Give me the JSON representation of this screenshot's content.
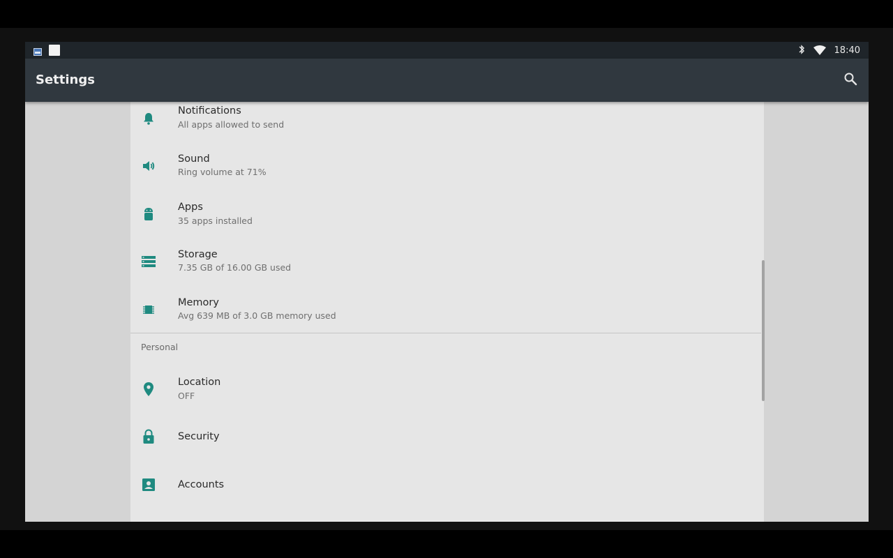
{
  "status_bar": {
    "time": "18:40",
    "left_icons": [
      "screen-cast-icon",
      "notification-square-icon"
    ],
    "right_icons": [
      "bluetooth-icon",
      "wifi-icon"
    ]
  },
  "app_bar": {
    "title": "Settings",
    "search_icon": "search-icon"
  },
  "colors": {
    "accent": "#1f8a80",
    "app_bar": "#30383f",
    "status_bar": "#1f252a",
    "content_bg": "#e6e6e6"
  },
  "device_items": [
    {
      "title": "Notifications",
      "summary": "All apps allowed to send",
      "icon": "bell-icon"
    },
    {
      "title": "Sound",
      "summary": "Ring volume at 71%",
      "icon": "volume-icon"
    },
    {
      "title": "Apps",
      "summary": "35 apps installed",
      "icon": "android-icon"
    },
    {
      "title": "Storage",
      "summary": "7.35 GB of 16.00 GB used",
      "icon": "storage-icon"
    },
    {
      "title": "Memory",
      "summary": "Avg 639 MB of 3.0 GB memory used",
      "icon": "memory-icon"
    }
  ],
  "personal_section": {
    "header": "Personal",
    "items": [
      {
        "title": "Location",
        "summary": "OFF",
        "icon": "location-pin-icon"
      },
      {
        "title": "Security",
        "icon": "lock-icon"
      },
      {
        "title": "Accounts",
        "icon": "account-box-icon"
      }
    ]
  }
}
